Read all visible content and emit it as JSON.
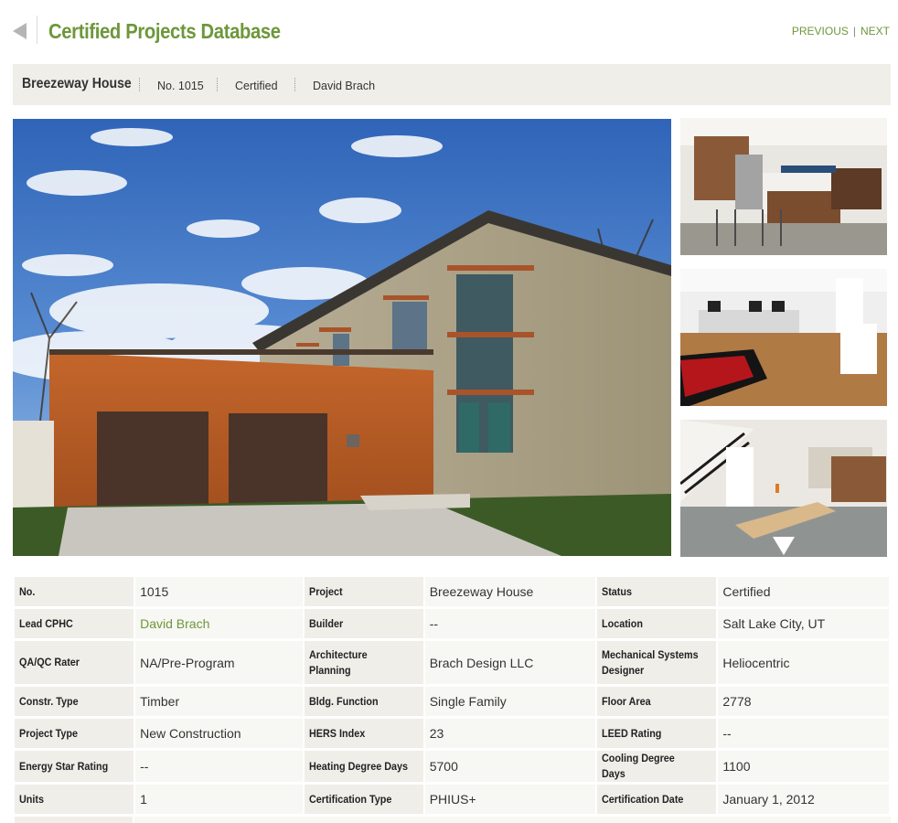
{
  "header": {
    "title": "Certified Projects Database",
    "previous_label": "PREVIOUS",
    "separator": "|",
    "next_label": "NEXT"
  },
  "project_bar": {
    "name": "Breezeway House",
    "number": "No. 1015",
    "status": "Certified",
    "person": "David Brach"
  },
  "gallery": {
    "main_photo": "house-exterior-photo",
    "thumbnails": [
      "kitchen-photo",
      "office-photo",
      "dining-room-photo"
    ]
  },
  "details": {
    "rows": [
      [
        {
          "label": "No.",
          "value": "1015"
        },
        {
          "label": "Project",
          "value": "Breezeway House"
        },
        {
          "label": "Status",
          "value": "Certified"
        }
      ],
      [
        {
          "label": "Lead CPHC",
          "value": "David Brach",
          "link": true
        },
        {
          "label": "Builder",
          "value": "--"
        },
        {
          "label": "Location",
          "value": "Salt Lake City, UT"
        }
      ],
      [
        {
          "label": "QA/QC Rater",
          "value": "NA/Pre-Program"
        },
        {
          "label": "Architecture Planning",
          "value": "Brach Design LLC"
        },
        {
          "label": "Mechanical Systems Designer",
          "value": "Heliocentric"
        }
      ],
      [
        {
          "label": "Constr. Type",
          "value": "Timber"
        },
        {
          "label": "Bldg. Function",
          "value": "Single Family"
        },
        {
          "label": "Floor Area",
          "value": "2778"
        }
      ],
      [
        {
          "label": "Project Type",
          "value": "New Construction"
        },
        {
          "label": "HERS Index",
          "value": "23"
        },
        {
          "label": "LEED Rating",
          "value": "--"
        }
      ],
      [
        {
          "label": "Energy Star Rating",
          "value": "--"
        },
        {
          "label": "Heating Degree Days",
          "value": "5700"
        },
        {
          "label": "Cooling Degree Days",
          "value": "1100"
        }
      ],
      [
        {
          "label": "Units",
          "value": "1"
        },
        {
          "label": "Certification Type",
          "value": "PHIUS+"
        },
        {
          "label": "Certification Date",
          "value": "January 1, 2012"
        }
      ]
    ]
  },
  "colors": {
    "accent_green": "#6d973a",
    "label_bg": "#efeee9",
    "value_bg": "#f7f7f3"
  }
}
